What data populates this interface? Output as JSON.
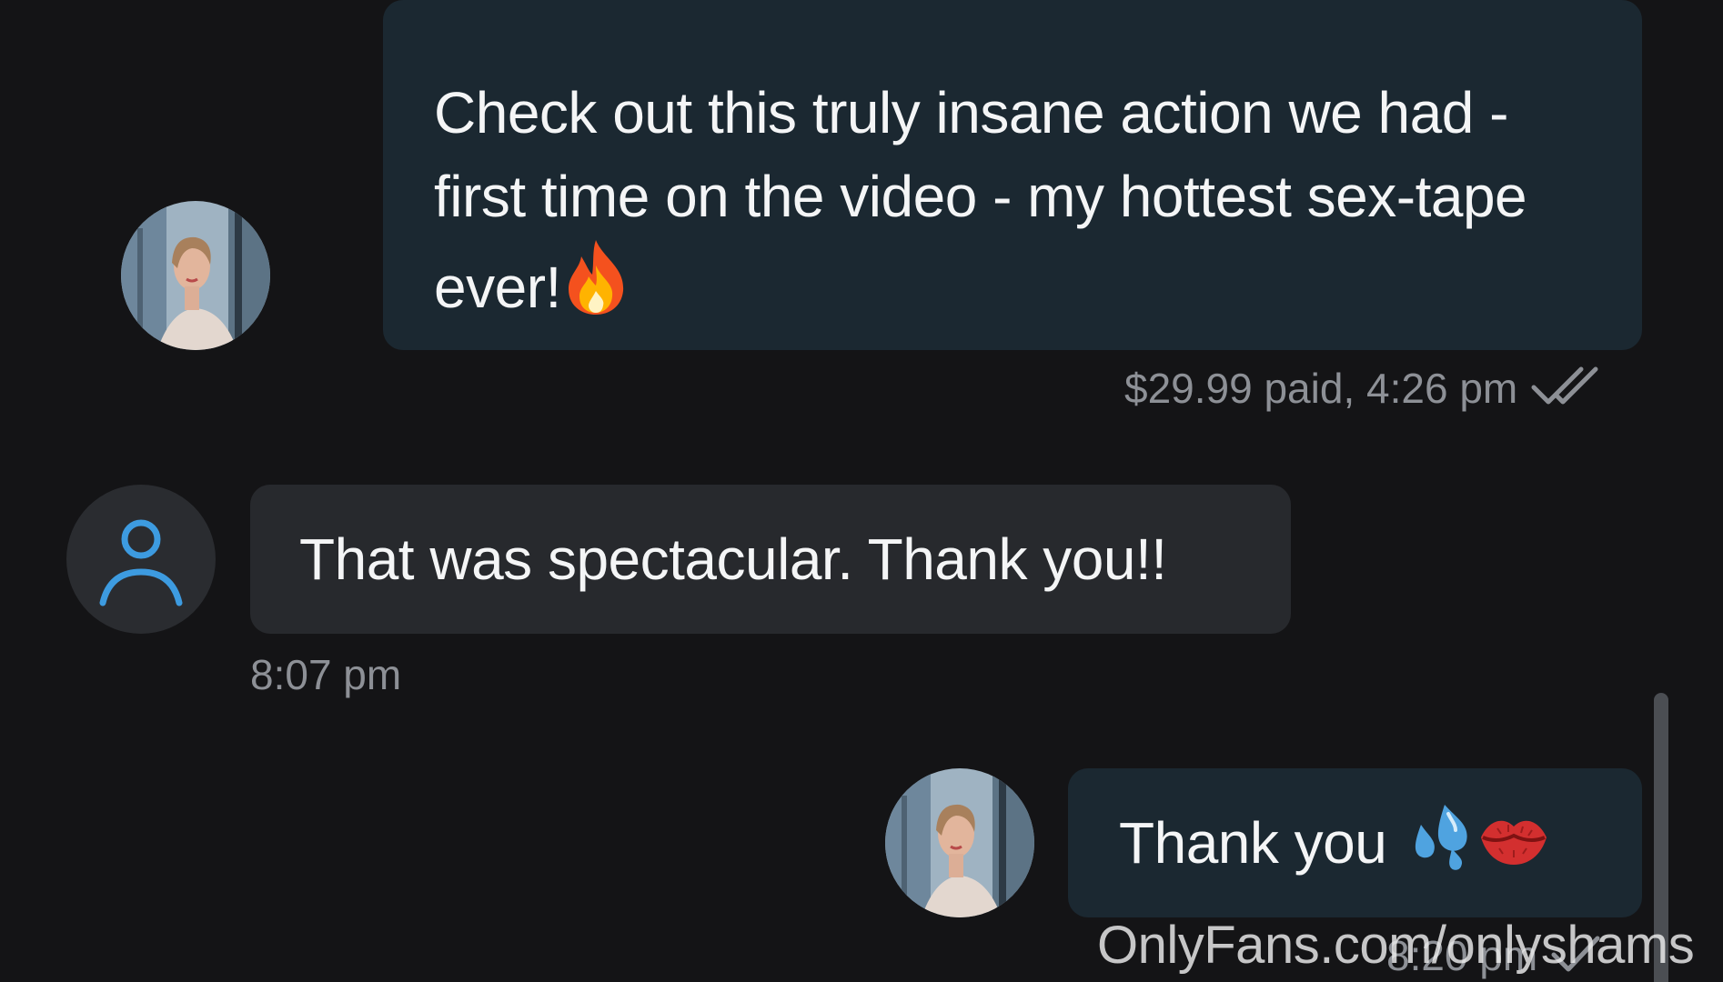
{
  "messages": [
    {
      "sender": "creator",
      "text": "Check out this truly insane action we had - first time on the video - my hottest sex-tape ever!",
      "emoji": "fire-emoji",
      "meta": "$29.99 paid, 4:26 pm",
      "status_icon": "double-check-icon"
    },
    {
      "sender": "fan",
      "text": "That was spectacular. Thank you!!",
      "meta": "8:07 pm",
      "avatar_icon": "user-outline-icon"
    },
    {
      "sender": "creator",
      "text": "Thank you",
      "emoji": [
        "sweat-droplets-emoji",
        "kiss-mark-emoji"
      ],
      "meta": "8:20 pm",
      "status_icon": "check-icon"
    }
  ],
  "watermark": "OnlyFans.com/onlyshams",
  "colors": {
    "background": "#141416",
    "outgoing_bubble": "#1b2831",
    "incoming_bubble": "#27292d",
    "meta_text": "#8d9096",
    "user_icon": "#3d9be0"
  }
}
